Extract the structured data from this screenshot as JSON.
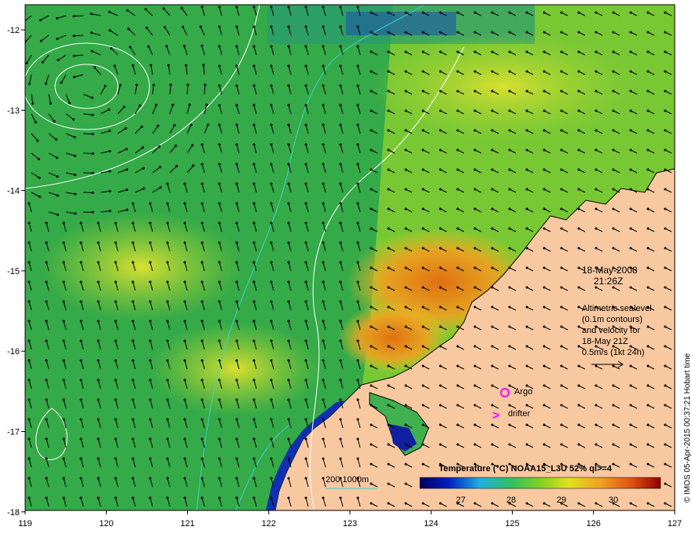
{
  "map": {
    "date_label": "18-May-2008",
    "time_label": "21:26Z",
    "altimetry_note": [
      "Altimetric sealevel",
      "(0.1m contours)",
      "and velocity for",
      "18-May 21Z",
      "0.5m/s (1kt 24h)"
    ],
    "legend_argo": "Argo",
    "legend_drifter": "drifter",
    "legend_argo_symbol": "○",
    "legend_drifter_symbol": ">",
    "bathy_legend": "200  1000m",
    "colorbar_title": "Temperature (°C) NOAA15_L3U 52% ql>=4",
    "colorbar_ticks": [
      "27",
      "28",
      "29",
      "30"
    ],
    "credit": "© IMOS 05-Apr-2015 00:37:21 Hobart time",
    "x_ticks": [
      "119",
      "120",
      "121",
      "122",
      "123",
      "124",
      "125",
      "126",
      "127"
    ],
    "y_ticks": [
      "-12",
      "-13",
      "-14",
      "-15",
      "-16",
      "-17",
      "-18"
    ],
    "colors": {
      "land": "#f8c8a0",
      "sea_green": "#3ab64a",
      "sea_warm": "#f0a020",
      "contour": "#ffffff",
      "bathy": "#40d0d0",
      "argo": "#ff00ff"
    }
  }
}
